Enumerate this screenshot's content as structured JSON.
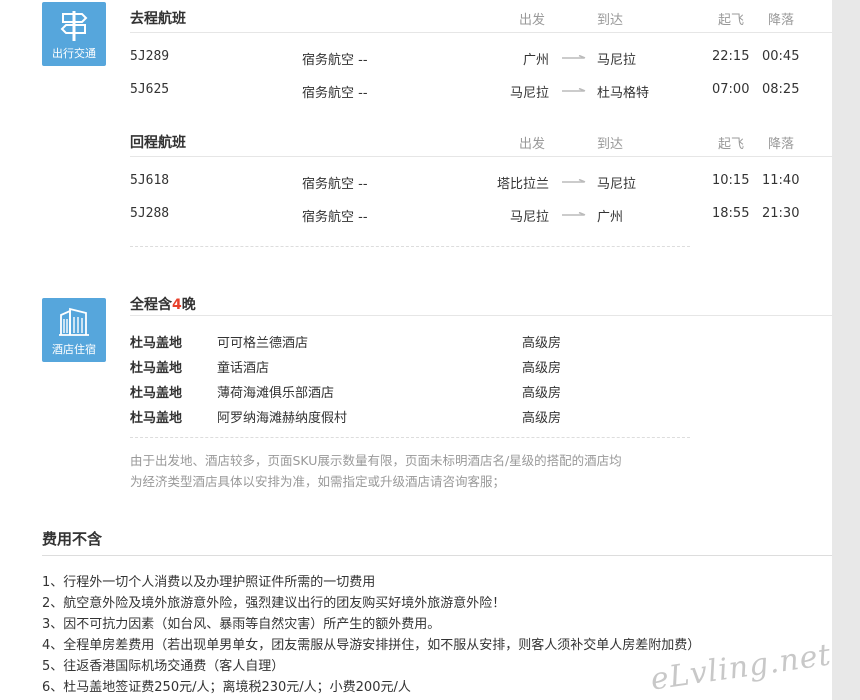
{
  "transport": {
    "badge_label": "出行交通",
    "outbound": {
      "title": "去程航班",
      "col_depart": "出发",
      "col_arrive": "到达",
      "col_takeoff": "起飞",
      "col_land": "降落",
      "rows": [
        {
          "flight": "5J289",
          "airline": "宿务航空 --",
          "from": "广州",
          "to": "马尼拉",
          "takeoff": "22:15",
          "land": "00:45"
        },
        {
          "flight": "5J625",
          "airline": "宿务航空 --",
          "from": "马尼拉",
          "to": "杜马格特",
          "takeoff": "07:00",
          "land": "08:25"
        }
      ]
    },
    "return": {
      "title": "回程航班",
      "col_depart": "出发",
      "col_arrive": "到达",
      "col_takeoff": "起飞",
      "col_land": "降落",
      "rows": [
        {
          "flight": "5J618",
          "airline": "宿务航空 --",
          "from": "塔比拉兰",
          "to": "马尼拉",
          "takeoff": "10:15",
          "land": "11:40"
        },
        {
          "flight": "5J288",
          "airline": "宿务航空 --",
          "from": "马尼拉",
          "to": "广州",
          "takeoff": "18:55",
          "land": "21:30"
        }
      ]
    }
  },
  "hotel": {
    "badge_label": "酒店住宿",
    "title_prefix": "全程含",
    "nights": "4",
    "title_suffix": "晚",
    "rows": [
      {
        "city": "杜马盖地",
        "name": "可可格兰德酒店",
        "room": "高级房"
      },
      {
        "city": "杜马盖地",
        "name": "童话酒店",
        "room": "高级房"
      },
      {
        "city": "杜马盖地",
        "name": "薄荷海滩俱乐部酒店",
        "room": "高级房"
      },
      {
        "city": "杜马盖地",
        "name": "阿罗纳海滩赫纳度假村",
        "room": "高级房"
      }
    ],
    "note_line1": "由于出发地、酒店较多，页面SKU展示数量有限，页面未标明酒店名/星级的搭配的酒店均",
    "note_line2": "为经济类型酒店具体以安排为准，如需指定或升级酒店请咨询客服；"
  },
  "exclusions": {
    "title": "费用不含",
    "items": [
      "1、行程外一切个人消费以及办理护照证件所需的一切费用",
      "2、航空意外险及境外旅游意外险，强烈建议出行的团友购买好境外旅游意外险！",
      "3、因不可抗力因素（如台风、暴雨等自然灾害）所产生的额外费用。",
      "4、全程单房差费用（若出现单男单女，团友需服从导游安排拼住，如不服从安排，则客人须补交单人房差附加费）",
      "5、往返香港国际机场交通费（客人自理）",
      "6、杜马盖地签证费250元/人；离境税230元/人；小费200元/人"
    ]
  },
  "watermark": "eLvling.net",
  "colors": {
    "badge": "#56a6dc",
    "accent": "#e8412c"
  }
}
